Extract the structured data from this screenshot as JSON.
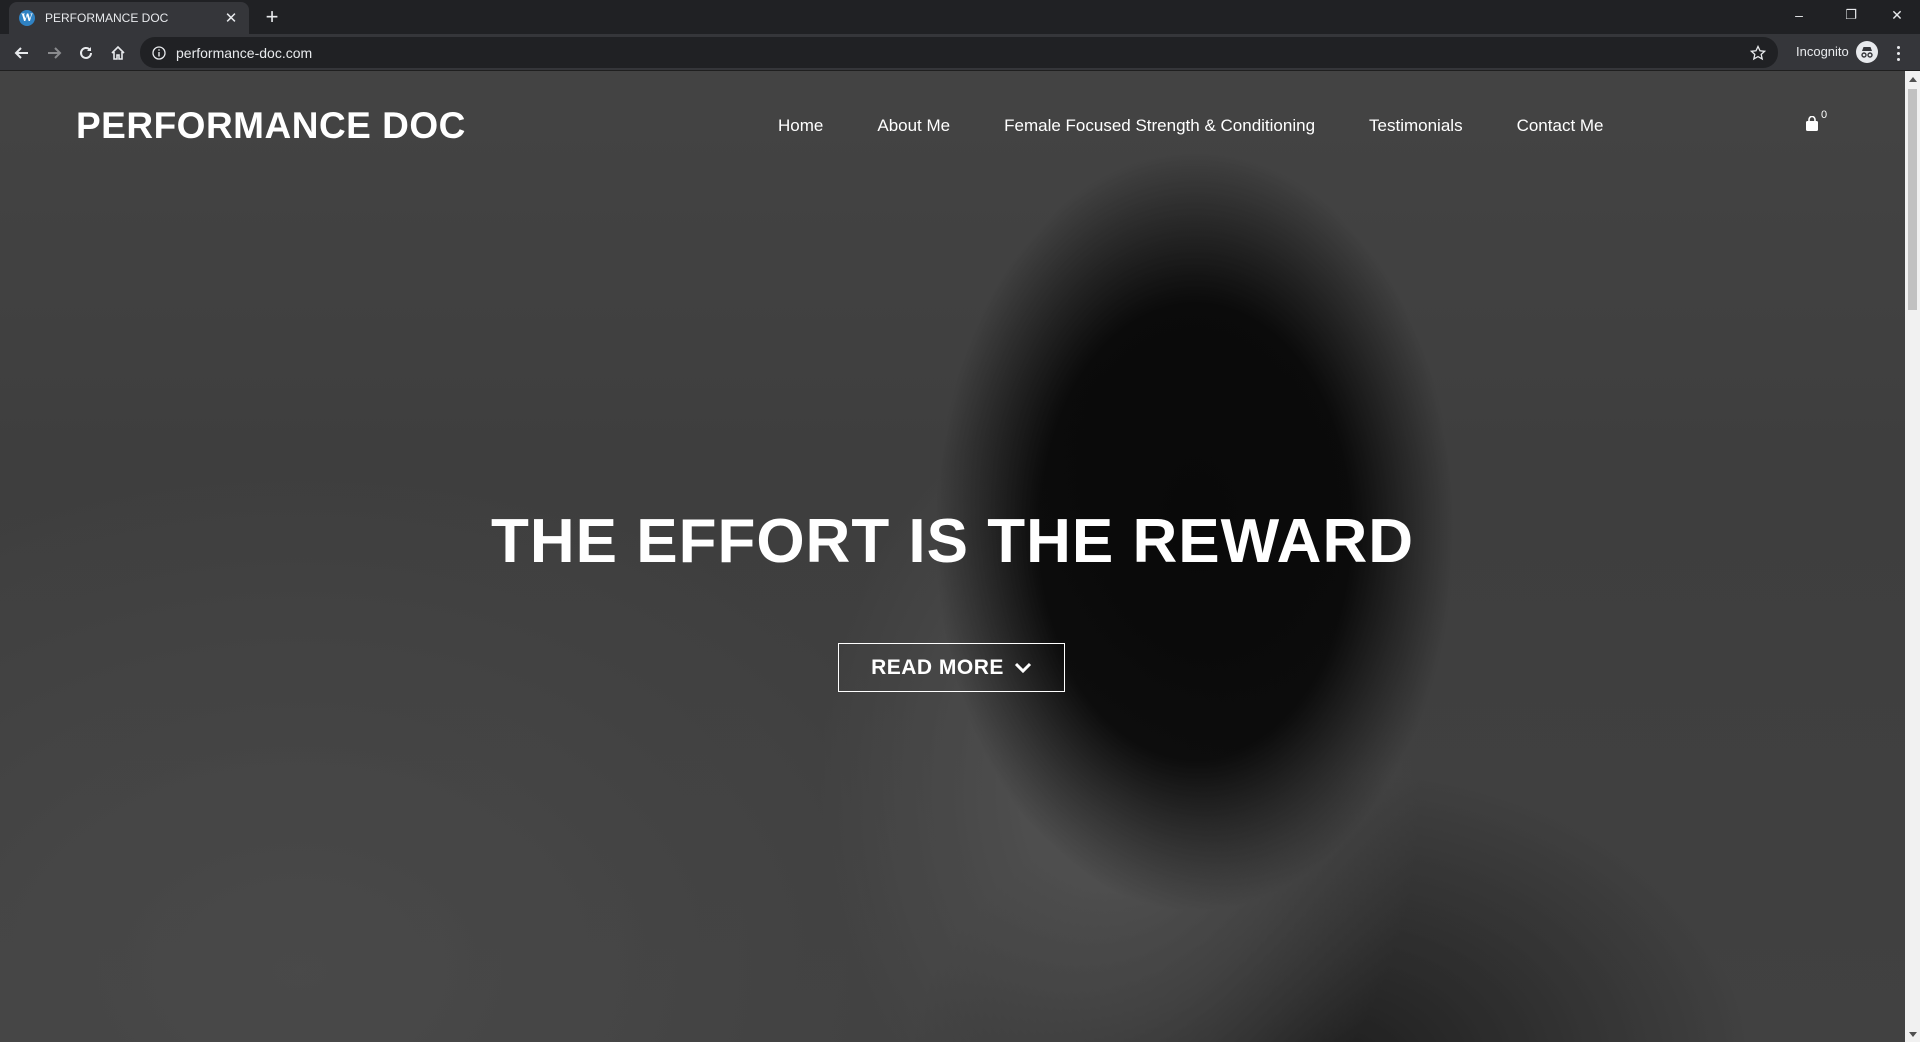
{
  "browser": {
    "tab_title": "PERFORMANCE DOC",
    "tab_favicon": "W",
    "tab_close": "✕",
    "new_tab": "+",
    "url": "performance-doc.com",
    "incognito_label": "Incognito",
    "window_controls": {
      "minimize": "–",
      "restore": "❐",
      "close": "✕"
    }
  },
  "site": {
    "logo": "PERFORMANCE DOC",
    "nav": [
      {
        "label": "Home"
      },
      {
        "label": "About Me"
      },
      {
        "label": "Female Focused Strength & Conditioning"
      },
      {
        "label": "Testimonials"
      },
      {
        "label": "Contact Me"
      }
    ],
    "cart_count": "0"
  },
  "hero": {
    "title": "THE EFFORT IS THE REWARD",
    "button_label": "READ MORE"
  },
  "colors": {
    "chrome_dark": "#202124",
    "chrome_toolbar": "#35363a",
    "text_light": "#e8eaed",
    "hero_text": "#ffffff"
  }
}
